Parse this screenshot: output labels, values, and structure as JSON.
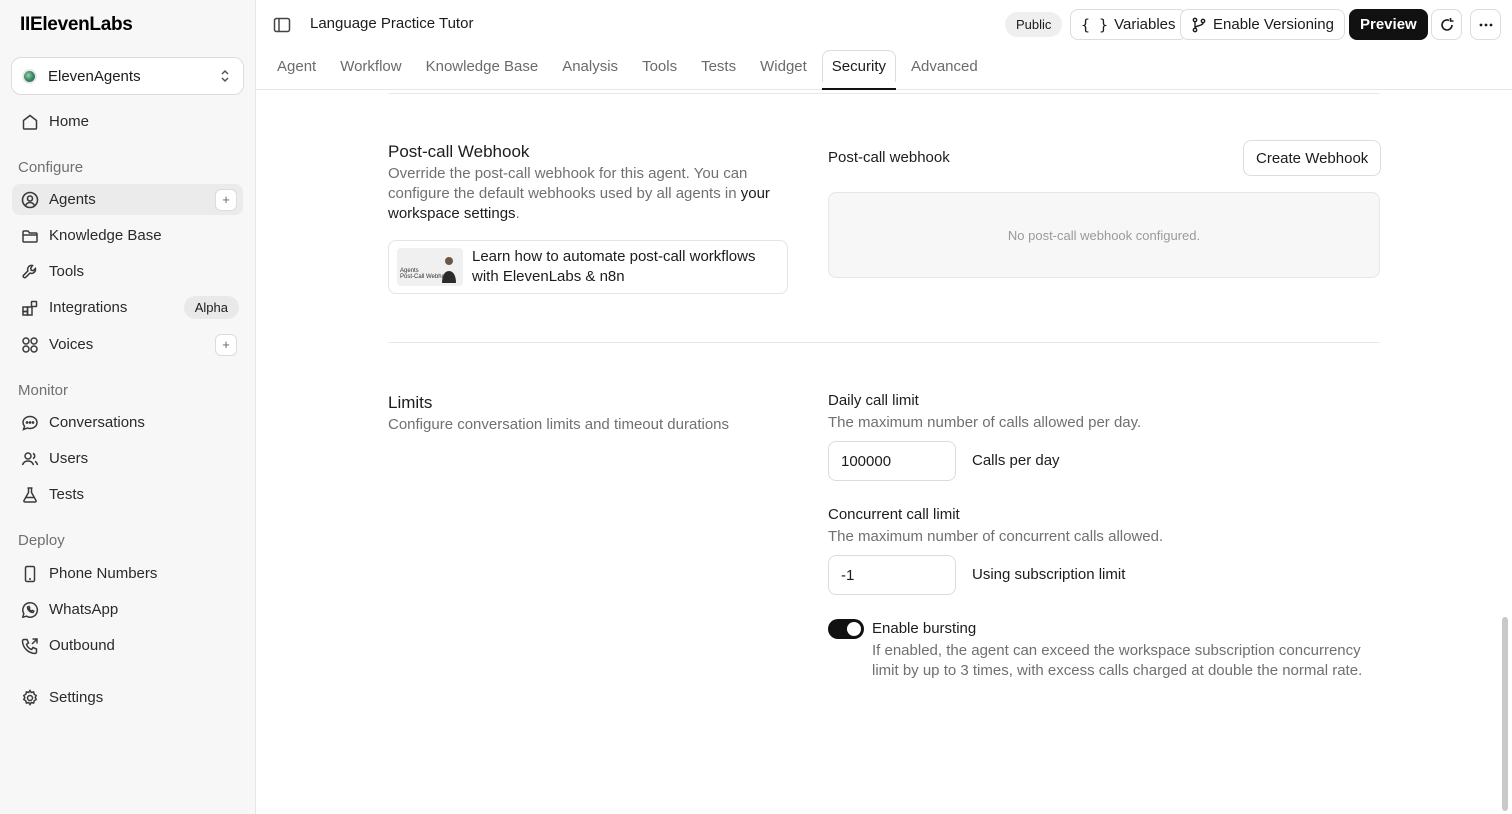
{
  "brand": {
    "logo_text": "IIElevenLabs"
  },
  "workspace": {
    "name": "ElevenAgents"
  },
  "sidebar": {
    "home": "Home",
    "sections": {
      "configure": "Configure",
      "monitor": "Monitor",
      "deploy": "Deploy"
    },
    "items": {
      "agents": "Agents",
      "knowledge_base": "Knowledge Base",
      "tools": "Tools",
      "integrations": "Integrations",
      "integrations_badge": "Alpha",
      "voices": "Voices",
      "conversations": "Conversations",
      "users": "Users",
      "tests": "Tests",
      "phone_numbers": "Phone Numbers",
      "whatsapp": "WhatsApp",
      "outbound": "Outbound",
      "settings": "Settings"
    },
    "active_item": "Agents"
  },
  "header": {
    "agent_title": "Language Practice Tutor",
    "visibility_badge": "Public",
    "variables_label": "Variables",
    "versioning_label": "Enable Versioning",
    "preview_label": "Preview"
  },
  "tabs": {
    "agent": "Agent",
    "workflow": "Workflow",
    "knowledge_base": "Knowledge Base",
    "analysis": "Analysis",
    "tools": "Tools",
    "tests": "Tests",
    "widget": "Widget",
    "security": "Security",
    "advanced": "Advanced",
    "active": "Security"
  },
  "webhook_section": {
    "title": "Post-call Webhook",
    "desc_part1": "Override the post-call webhook for this agent. You can configure the default webhooks used by all agents in ",
    "desc_link": "your workspace settings",
    "desc_end": ".",
    "learn_line1": "Learn how to automate post-call workflows",
    "learn_line2": "with ElevenLabs & n8n",
    "thumb_caption_line1": "Agents",
    "thumb_caption_line2": "Post-Call Webhooks",
    "field_label": "Post-call webhook",
    "create_button": "Create Webhook",
    "empty_text": "No post-call webhook configured."
  },
  "limits_section": {
    "title": "Limits",
    "desc": "Configure conversation limits and timeout durations",
    "daily": {
      "label": "Daily call limit",
      "help": "The maximum number of calls allowed per day.",
      "value": "100000",
      "suffix": "Calls per day"
    },
    "concurrent": {
      "label": "Concurrent call limit",
      "help": "The maximum number of concurrent calls allowed.",
      "value": "-1",
      "suffix": "Using subscription limit"
    },
    "bursting": {
      "label": "Enable bursting",
      "enabled": true,
      "help_line1": "If enabled, the agent can exceed the workspace subscription concurrency",
      "help_line2": "limit by up to 3 times, with excess calls charged at double the normal rate."
    }
  }
}
